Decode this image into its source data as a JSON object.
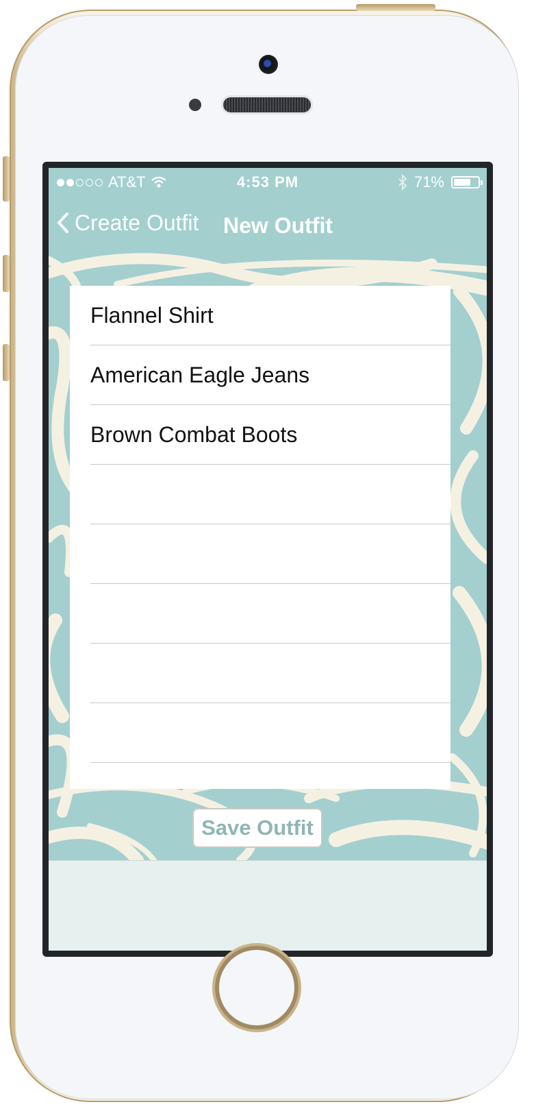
{
  "status_bar": {
    "carrier": "AT&T",
    "time": "4:53 PM",
    "battery": "71%",
    "battery_level": 0.71,
    "signal_bars_filled": 2,
    "signal_bars_total": 5,
    "wifi_icon": "wifi-icon",
    "bluetooth_icon": "bluetooth-icon"
  },
  "nav": {
    "back_label": "Create Outfit",
    "title": "New Outfit"
  },
  "items": [
    {
      "label": "Flannel Shirt"
    },
    {
      "label": "American Eagle Jeans"
    },
    {
      "label": "Brown Combat Boots"
    },
    {
      "label": ""
    },
    {
      "label": ""
    },
    {
      "label": ""
    },
    {
      "label": ""
    },
    {
      "label": ""
    }
  ],
  "actions": {
    "save_label": "Save Outfit"
  },
  "colors": {
    "accent": "#a3cfcf",
    "pattern_cream": "#f5f1e2",
    "button_text": "#8eb6b4"
  }
}
